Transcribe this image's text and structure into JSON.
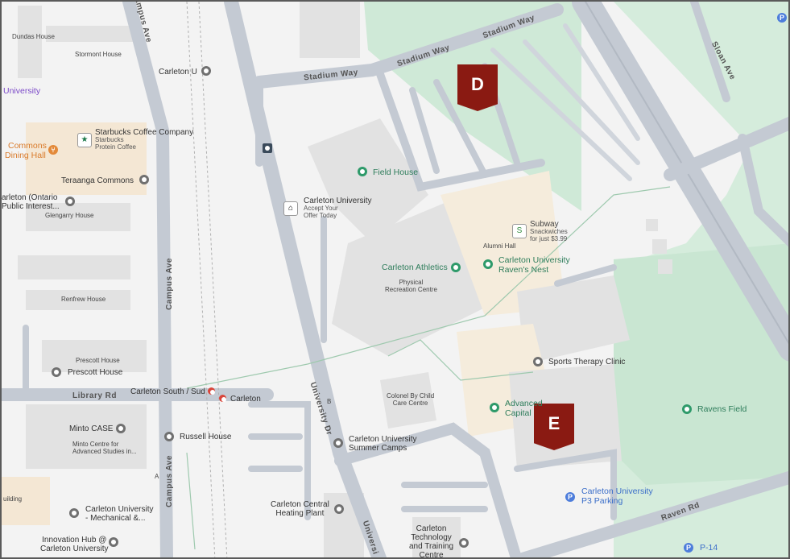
{
  "colors": {
    "park": "#cfe9d7",
    "building": "#e0e0e0",
    "road": "#c4cad3",
    "marker": "#8a1a12"
  },
  "roads": {
    "stadium_way_1": "Stadium Way",
    "stadium_way_2": "Stadium Way",
    "stadium_way_3": "Stadium Way",
    "campus_ave_1": "Campus Ave",
    "campus_ave_2": "Campus Ave",
    "campus_ave_3": "Campus Ave",
    "library_rd": "Library Rd",
    "university_dr": "University Dr",
    "university_dr_2": "Universi",
    "sloan_ave": "Sloan Ave",
    "raven_rd": "Raven Rd"
  },
  "markers": {
    "d": "D",
    "e": "E"
  },
  "places": {
    "dundas_house": "Dundas House",
    "stormont_house": "Stormont House",
    "university": "University",
    "carleton_u": "Carleton U",
    "commons": "Commons",
    "dining_hall": "Dining Hall",
    "starbucks": "Starbucks Coffee Company",
    "starbucks_sub1": "Starbucks",
    "starbucks_sub2": "Protein Coffee",
    "teraanga": "Teraanga Commons",
    "carleton_ontario": "arleton (Ontario",
    "public_interest": "Public Interest...",
    "glengarry": "Glengarry House",
    "renfrew": "Renfrew House",
    "prescott_top": "Prescott House",
    "prescott": "Prescott House",
    "carleton_south": "Carleton South / Sud",
    "carleton_station": "Carleton",
    "minto_case": "Minto CASE",
    "minto_centre": "Minto Centre for",
    "minto_centre2": "Advanced Studies in...",
    "russell": "Russell House",
    "building": "uilding",
    "carleton_mech": "Carleton University",
    "carleton_mech2": "- Mechanical &...",
    "innovation": "Innovation Hub @",
    "innovation2": "Carleton University",
    "field_house": "Field House",
    "carleton_university": "Carleton University",
    "accept_your": "Accept Your",
    "offer_today": "Offer Today",
    "subway": "Subway",
    "subway_sub1": "Snackwiches",
    "subway_sub2": "for just $3.99",
    "alumni_hall": "Alumni Hall",
    "athletics": "Carleton Athletics",
    "ravens_nest": "Carleton University",
    "ravens_nest2": "Raven's Nest",
    "physical": "Physical",
    "recreation": "Recreation Centre",
    "sports_therapy": "Sports Therapy Clinic",
    "colonel_by": "Colonel By Child",
    "care_centre": "Care Centre",
    "advanced": "Advanced",
    "capital": "Capital",
    "summer_camps": "Carleton University",
    "summer_camps2": "Summer Camps",
    "ravens_field": "Ravens Field",
    "p3_parking": "Carleton University",
    "p3_parking2": "P3 Parking",
    "central_heating": "Carleton Central",
    "central_heating2": "Heating Plant",
    "tech_training": "Carleton",
    "tech_training2": "Technology",
    "tech_training3": "and Training",
    "tech_training4": "Centre",
    "p14": "P-14",
    "b_label": "B",
    "a_label": "A",
    "p_corner": "P"
  }
}
